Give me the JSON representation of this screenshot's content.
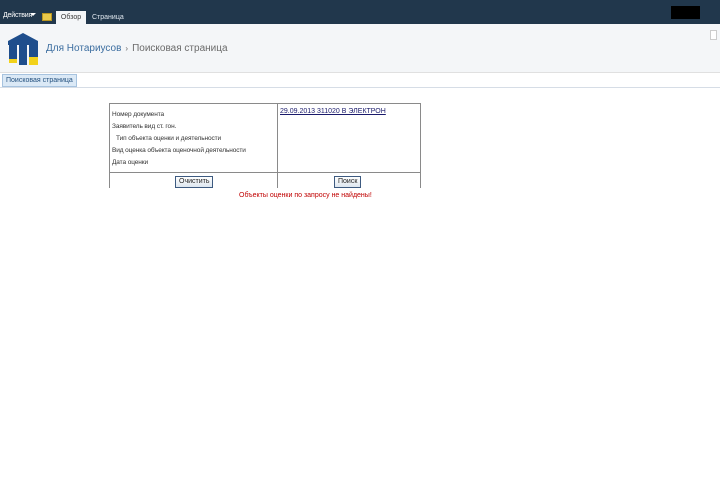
{
  "ribbon": {
    "site_actions": "Действия",
    "tab_active": "Обзор",
    "tab_page": "Страница"
  },
  "header": {
    "breadcrumb_root": "Для Нотариусов",
    "breadcrumb_sep": "›",
    "breadcrumb_current": "Поисковая страница"
  },
  "nav": {
    "pill": "Поисковая страница"
  },
  "form": {
    "labels": [
      "Номер документа",
      "Заявитель вид ст. гон.",
      "Тип объекта оценки и деятельности",
      "Вид оценка объекта оценочной деятельности",
      "Дата оценки"
    ],
    "value_link": "29.09.2013 311020 В ЭЛЕКТРОН",
    "clear_button": "Очистить",
    "search_button": "Поиск"
  },
  "error": "Объекты оценки по запросу не найдены!",
  "colors": {
    "topbar": "#21374c",
    "header_bg": "#f4f6f8",
    "error": "#c00000",
    "logo_blue": "#1f4e8c",
    "logo_yellow": "#f2d21b"
  }
}
